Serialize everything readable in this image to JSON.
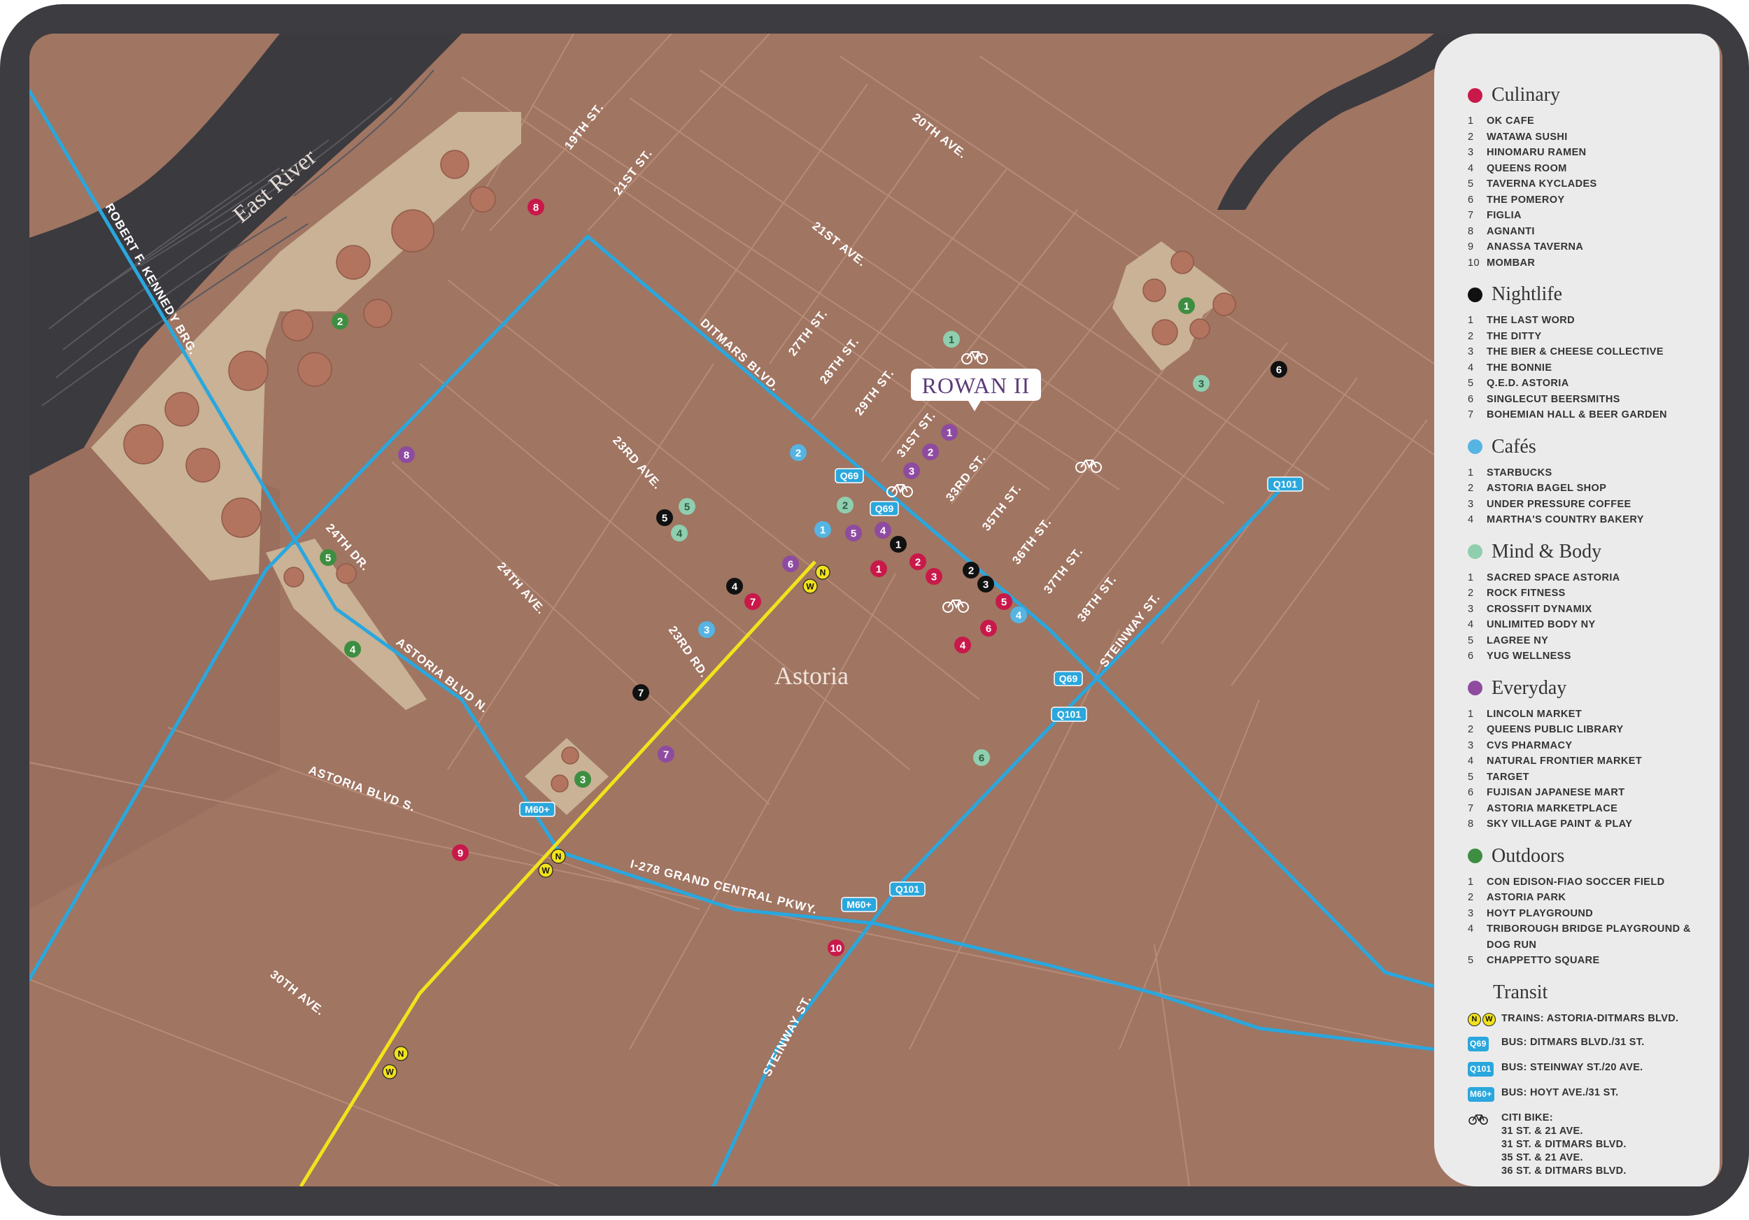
{
  "map": {
    "area_label": "Astoria",
    "river_label": "East River",
    "building_label": "ROWAN II",
    "streets": [
      {
        "id": "19th-st",
        "label": "19TH ST."
      },
      {
        "id": "21st-st",
        "label": "21ST ST."
      },
      {
        "id": "20th-ave",
        "label": "20TH AVE."
      },
      {
        "id": "21st-ave",
        "label": "21ST AVE."
      },
      {
        "id": "ditmars-blvd",
        "label": "DITMARS BLVD."
      },
      {
        "id": "27th-st",
        "label": "27TH ST."
      },
      {
        "id": "28th-st",
        "label": "28TH ST."
      },
      {
        "id": "29th-st",
        "label": "29TH ST."
      },
      {
        "id": "31st-st",
        "label": "31ST ST."
      },
      {
        "id": "33rd-st",
        "label": "33RD ST."
      },
      {
        "id": "35th-st",
        "label": "35TH ST."
      },
      {
        "id": "36th-st",
        "label": "36TH ST."
      },
      {
        "id": "37th-st",
        "label": "37TH ST."
      },
      {
        "id": "38th-st",
        "label": "38TH ST."
      },
      {
        "id": "steinway-st-upper",
        "label": "STEINWAY ST."
      },
      {
        "id": "steinway-st-lower",
        "label": "STEINWAY ST."
      },
      {
        "id": "23rd-ave",
        "label": "23RD AVE."
      },
      {
        "id": "24th-ave",
        "label": "24TH AVE."
      },
      {
        "id": "23rd-rd",
        "label": "23RD RD."
      },
      {
        "id": "24th-dr",
        "label": "24TH DR."
      },
      {
        "id": "astoria-blvd-n",
        "label": "ASTORIA BLVD N."
      },
      {
        "id": "astoria-blvd-s",
        "label": "ASTORIA BLVD S."
      },
      {
        "id": "grand-central",
        "label": "I-278 GRAND CENTRAL PKWY."
      },
      {
        "id": "30th-ave",
        "label": "30TH AVE."
      },
      {
        "id": "rfk-brg",
        "label": "ROBERT F. KENNEDY BRG."
      }
    ],
    "bus_badges": [
      {
        "id": "q69-a",
        "label": "Q69"
      },
      {
        "id": "q69-b",
        "label": "Q69"
      },
      {
        "id": "q69-c",
        "label": "Q69"
      },
      {
        "id": "q101-a",
        "label": "Q101"
      },
      {
        "id": "q101-b",
        "label": "Q101"
      },
      {
        "id": "q101-c",
        "label": "Q101"
      },
      {
        "id": "m60-a",
        "label": "M60+"
      },
      {
        "id": "m60-b",
        "label": "M60+"
      }
    ],
    "train_stops": [
      {
        "id": "ditmars",
        "lines": [
          "N",
          "W"
        ]
      },
      {
        "id": "astoria-blvd",
        "lines": [
          "N",
          "W"
        ]
      },
      {
        "id": "30th-ave",
        "lines": [
          "N",
          "W"
        ]
      }
    ],
    "poi_markers": [
      {
        "category": "culinary",
        "label": "1"
      },
      {
        "category": "culinary",
        "label": "2"
      },
      {
        "category": "culinary",
        "label": "3"
      },
      {
        "category": "culinary",
        "label": "4"
      },
      {
        "category": "culinary",
        "label": "5"
      },
      {
        "category": "culinary",
        "label": "6"
      },
      {
        "category": "culinary",
        "label": "7"
      },
      {
        "category": "culinary",
        "label": "8"
      },
      {
        "category": "culinary",
        "label": "9"
      },
      {
        "category": "culinary",
        "label": "10"
      },
      {
        "category": "nightlife",
        "label": "1"
      },
      {
        "category": "nightlife",
        "label": "2"
      },
      {
        "category": "nightlife",
        "label": "3"
      },
      {
        "category": "nightlife",
        "label": "4"
      },
      {
        "category": "nightlife",
        "label": "5"
      },
      {
        "category": "nightlife",
        "label": "6"
      },
      {
        "category": "nightlife",
        "label": "7"
      },
      {
        "category": "cafes",
        "label": "1"
      },
      {
        "category": "cafes",
        "label": "2"
      },
      {
        "category": "cafes",
        "label": "3"
      },
      {
        "category": "cafes",
        "label": "4"
      },
      {
        "category": "mind_body",
        "label": "1"
      },
      {
        "category": "mind_body",
        "label": "2"
      },
      {
        "category": "mind_body",
        "label": "3"
      },
      {
        "category": "mind_body",
        "label": "4"
      },
      {
        "category": "mind_body",
        "label": "5"
      },
      {
        "category": "mind_body",
        "label": "6"
      },
      {
        "category": "everyday",
        "label": "1"
      },
      {
        "category": "everyday",
        "label": "2"
      },
      {
        "category": "everyday",
        "label": "3"
      },
      {
        "category": "everyday",
        "label": "4"
      },
      {
        "category": "everyday",
        "label": "5"
      },
      {
        "category": "everyday",
        "label": "6"
      },
      {
        "category": "everyday",
        "label": "7"
      },
      {
        "category": "everyday",
        "label": "8"
      },
      {
        "category": "outdoors",
        "label": "1"
      },
      {
        "category": "outdoors",
        "label": "2"
      },
      {
        "category": "outdoors",
        "label": "3"
      },
      {
        "category": "outdoors",
        "label": "4"
      },
      {
        "category": "outdoors",
        "label": "5"
      }
    ],
    "bike_icons": 4
  },
  "colors": {
    "land": "#a07562",
    "park": "#c9b295",
    "water": "#3b3a3f",
    "street_line": "#b68b78",
    "bus_route": "#2aa7dd",
    "train_route": "#f2e21c",
    "label": "#ffffff",
    "culinary": "#c8194a",
    "nightlife": "#111111",
    "cafes": "#56b4e3",
    "mind_body": "#8fceae",
    "everyday": "#8e4ba0",
    "outdoors": "#3e8e41"
  },
  "legend": {
    "categories": [
      {
        "key": "culinary",
        "title": "Culinary",
        "items": [
          "OK CAFE",
          "WATAWA SUSHI",
          "HINOMARU RAMEN",
          "QUEENS ROOM",
          "TAVERNA KYCLADES",
          "THE POMEROY",
          "FIGLIA",
          "AGNANTI",
          "ANASSA TAVERNA",
          "MOMBAR"
        ]
      },
      {
        "key": "nightlife",
        "title": "Nightlife",
        "items": [
          "THE LAST WORD",
          "THE DITTY",
          "THE BIER & CHEESE COLLECTIVE",
          "THE BONNIE",
          "Q.E.D. ASTORIA",
          "SINGLECUT BEERSMITHS",
          "BOHEMIAN HALL & BEER GARDEN"
        ]
      },
      {
        "key": "cafes",
        "title": "Cafés",
        "items": [
          "STARBUCKS",
          "ASTORIA BAGEL SHOP",
          "UNDER PRESSURE COFFEE",
          "MARTHA'S COUNTRY BAKERY"
        ]
      },
      {
        "key": "mind_body",
        "title": "Mind & Body",
        "items": [
          "SACRED SPACE ASTORIA",
          "ROCK FITNESS",
          "CROSSFIT DYNAMIX",
          "UNLIMITED BODY NY",
          "LAGREE NY",
          "YUG WELLNESS"
        ]
      },
      {
        "key": "everyday",
        "title": "Everyday",
        "items": [
          "LINCOLN MARKET",
          "QUEENS PUBLIC LIBRARY",
          "CVS PHARMACY",
          "NATURAL FRONTIER MARKET",
          "TARGET",
          "FUJISAN JAPANESE MART",
          "ASTORIA MARKETPLACE",
          "SKY VILLAGE PAINT & PLAY"
        ]
      },
      {
        "key": "outdoors",
        "title": "Outdoors",
        "items": [
          "CON EDISON-FIAO SOCCER FIELD",
          "ASTORIA PARK",
          "HOYT PLAYGROUND",
          "TRIBOROUGH BRIDGE PLAYGROUND & DOG RUN",
          "CHAPPETTO SQUARE"
        ]
      }
    ],
    "transit": {
      "title": "Transit",
      "train_badges": [
        "N",
        "W"
      ],
      "train_label": "TRAINS: ASTORIA-DITMARS BLVD.",
      "bus": [
        {
          "badge": "Q69",
          "label": "BUS: DITMARS BLVD./31 ST."
        },
        {
          "badge": "Q101",
          "label": "BUS: STEINWAY ST./20 AVE."
        },
        {
          "badge": "M60+",
          "label": "BUS: HOYT AVE./31 ST."
        }
      ],
      "bike_title": "CITI BIKE:",
      "bike_locations": [
        "31 ST. & 21 AVE.",
        "31 ST. & DITMARS BLVD.",
        "35 ST. & 21 AVE.",
        "36 ST. & DITMARS BLVD."
      ]
    }
  }
}
